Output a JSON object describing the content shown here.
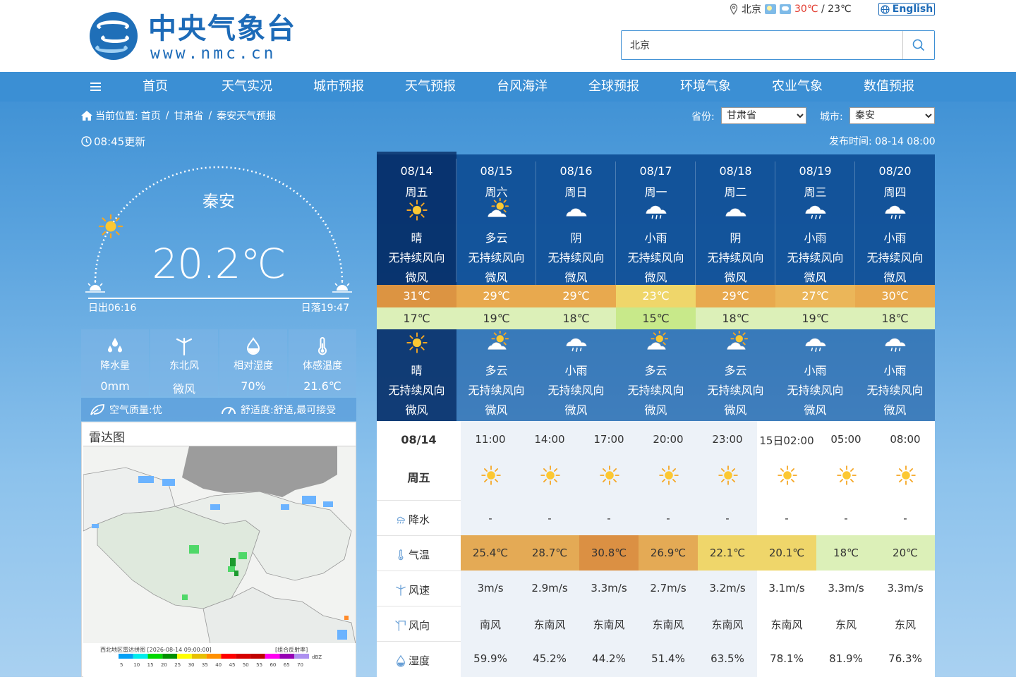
{
  "header": {
    "logo_title": "中央气象台",
    "logo_url": "www.nmc.cn",
    "top_city": "北京",
    "top_temp_high": "30℃",
    "top_temp_sep": " / ",
    "top_temp_low": "23℃",
    "english_label": "English",
    "search_value": "北京"
  },
  "nav": {
    "items": [
      "首页",
      "天气实况",
      "城市预报",
      "天气预报",
      "台风海洋",
      "全球预报",
      "环境气象",
      "农业气象",
      "数值预报"
    ]
  },
  "breadcrumb": {
    "prefix": "当前位置:",
    "items": [
      "首页",
      "甘肃省",
      "秦安天气预报"
    ],
    "sep": "/"
  },
  "update_label": "08:45更新",
  "selectors": {
    "province_label": "省份:",
    "province_value": "甘肃省",
    "city_label": "城市:",
    "city_value": "秦安"
  },
  "publish": {
    "label": "发布时间:",
    "value": "08-14 08:00"
  },
  "current": {
    "city": "秦安",
    "temp": "20.2℃",
    "sunrise": "日出06:16",
    "sunset": "日落19:47",
    "sun_progress": 0.16
  },
  "stats": [
    {
      "icon": "raindrops-icon",
      "label": "降水量",
      "value": "0mm"
    },
    {
      "icon": "wind-turbine-icon",
      "label": "东北风",
      "value": "微风"
    },
    {
      "icon": "humidity-drop-icon",
      "label": "相对湿度",
      "value": "70%"
    },
    {
      "icon": "thermometer-icon",
      "label": "体感温度",
      "value": "21.6℃"
    }
  ],
  "air_quality": "空气质量:优",
  "comfort": "舒适度:舒适,最可接受",
  "radar": {
    "title": "雷达图",
    "caption": "西北地区雷达拼图 [2026-08-14 09:00:00]",
    "product": "[组合反射率]",
    "scale": [
      "5",
      "10",
      "15",
      "20",
      "25",
      "30",
      "35",
      "40",
      "45",
      "50",
      "55",
      "60",
      "65",
      "70"
    ],
    "unit": "dBZ",
    "scale_colors": [
      "#01a0f6",
      "#00ecec",
      "#00d800",
      "#019000",
      "#ffff00",
      "#e7c000",
      "#ff9000",
      "#ff0000",
      "#d60000",
      "#c00000",
      "#ff00f0",
      "#9600b4",
      "#ad90f0"
    ]
  },
  "forecast_days": [
    {
      "date": "08/14",
      "weekday": "周五",
      "day_icon": "sun-icon",
      "day_weather": "晴",
      "day_wind_dir": "无持续风向",
      "day_wind": "微风",
      "high": "31℃",
      "low": "17℃",
      "night_icon": "sun-icon",
      "night_weather": "晴",
      "night_wind_dir": "无持续风向",
      "night_wind": "微风",
      "hi_color": "#dc9442",
      "lo_color": "#dcf0b8"
    },
    {
      "date": "08/15",
      "weekday": "周六",
      "day_icon": "partly-cloudy-icon",
      "day_weather": "多云",
      "day_wind_dir": "无持续风向",
      "day_wind": "微风",
      "high": "29℃",
      "low": "19℃",
      "night_icon": "partly-cloudy-icon",
      "night_weather": "多云",
      "night_wind_dir": "无持续风向",
      "night_wind": "微风",
      "hi_color": "#e8a94e",
      "lo_color": "#dcf0b8"
    },
    {
      "date": "08/16",
      "weekday": "周日",
      "day_icon": "overcast-icon",
      "day_weather": "阴",
      "day_wind_dir": "无持续风向",
      "day_wind": "微风",
      "high": "29℃",
      "low": "18℃",
      "night_icon": "light-rain-icon",
      "night_weather": "小雨",
      "night_wind_dir": "无持续风向",
      "night_wind": "微风",
      "hi_color": "#e8a94e",
      "lo_color": "#dcf0b8"
    },
    {
      "date": "08/17",
      "weekday": "周一",
      "day_icon": "light-rain-icon",
      "day_weather": "小雨",
      "day_wind_dir": "无持续风向",
      "day_wind": "微风",
      "high": "23℃",
      "low": "15℃",
      "night_icon": "partly-cloudy-icon",
      "night_weather": "多云",
      "night_wind_dir": "无持续风向",
      "night_wind": "微风",
      "hi_color": "#efd66a",
      "lo_color": "#c8e98a"
    },
    {
      "date": "08/18",
      "weekday": "周二",
      "day_icon": "overcast-icon",
      "day_weather": "阴",
      "day_wind_dir": "无持续风向",
      "day_wind": "微风",
      "high": "29℃",
      "low": "18℃",
      "night_icon": "partly-cloudy-icon",
      "night_weather": "多云",
      "night_wind_dir": "无持续风向",
      "night_wind": "微风",
      "hi_color": "#e8a94e",
      "lo_color": "#dcf0b8"
    },
    {
      "date": "08/19",
      "weekday": "周三",
      "day_icon": "light-rain-icon",
      "day_weather": "小雨",
      "day_wind_dir": "无持续风向",
      "day_wind": "微风",
      "high": "27℃",
      "low": "19℃",
      "night_icon": "light-rain-icon",
      "night_weather": "小雨",
      "night_wind_dir": "无持续风向",
      "night_wind": "微风",
      "hi_color": "#ebb659",
      "lo_color": "#dcf0b8"
    },
    {
      "date": "08/20",
      "weekday": "周四",
      "day_icon": "light-rain-icon",
      "day_weather": "小雨",
      "day_wind_dir": "无持续风向",
      "day_wind": "微风",
      "high": "30℃",
      "low": "18℃",
      "night_icon": "light-rain-icon",
      "night_weather": "小雨",
      "night_wind_dir": "无持续风向",
      "night_wind": "微风",
      "hi_color": "#e8a94e",
      "lo_color": "#dcf0b8"
    }
  ],
  "hourly": {
    "date": "08/14",
    "weekday": "周五",
    "row_labels": {
      "precip": "降水",
      "temp": "气温",
      "wind_speed": "风速",
      "wind_dir": "风向",
      "humidity": "湿度"
    },
    "slots": [
      {
        "time": "11:00",
        "icon": "sun-icon",
        "precip": "-",
        "temp": "25.4℃",
        "temp_color": "#e4aa55",
        "wind_speed": "3m/s",
        "wind_dir": "南风",
        "humidity": "59.9%"
      },
      {
        "time": "14:00",
        "icon": "sun-icon",
        "precip": "-",
        "temp": "28.7℃",
        "temp_color": "#e4aa55",
        "wind_speed": "2.9m/s",
        "wind_dir": "东南风",
        "humidity": "45.2%"
      },
      {
        "time": "17:00",
        "icon": "sun-icon",
        "precip": "-",
        "temp": "30.8℃",
        "temp_color": "#db9043",
        "wind_speed": "3.3m/s",
        "wind_dir": "东南风",
        "humidity": "44.2%"
      },
      {
        "time": "20:00",
        "icon": "sun-icon",
        "precip": "-",
        "temp": "26.9℃",
        "temp_color": "#e4aa55",
        "wind_speed": "2.7m/s",
        "wind_dir": "东南风",
        "humidity": "51.4%"
      },
      {
        "time": "23:00",
        "icon": "sun-icon",
        "precip": "-",
        "temp": "22.1℃",
        "temp_color": "#efd66a",
        "wind_speed": "3.2m/s",
        "wind_dir": "东南风",
        "humidity": "63.5%"
      },
      {
        "time": "15日02:00",
        "icon": "sun-icon",
        "precip": "-",
        "temp": "20.1℃",
        "temp_color": "#efd66a",
        "wind_speed": "3.1m/s",
        "wind_dir": "东南风",
        "humidity": "78.1%"
      },
      {
        "time": "05:00",
        "icon": "sun-icon",
        "precip": "-",
        "temp": "18℃",
        "temp_color": "#dcf0b8",
        "wind_speed": "3.3m/s",
        "wind_dir": "东风",
        "humidity": "81.9%"
      },
      {
        "time": "08:00",
        "icon": "sun-icon",
        "precip": "-",
        "temp": "20℃",
        "temp_color": "#dcf0b8",
        "wind_speed": "3.3m/s",
        "wind_dir": "东风",
        "humidity": "76.3%"
      }
    ]
  }
}
